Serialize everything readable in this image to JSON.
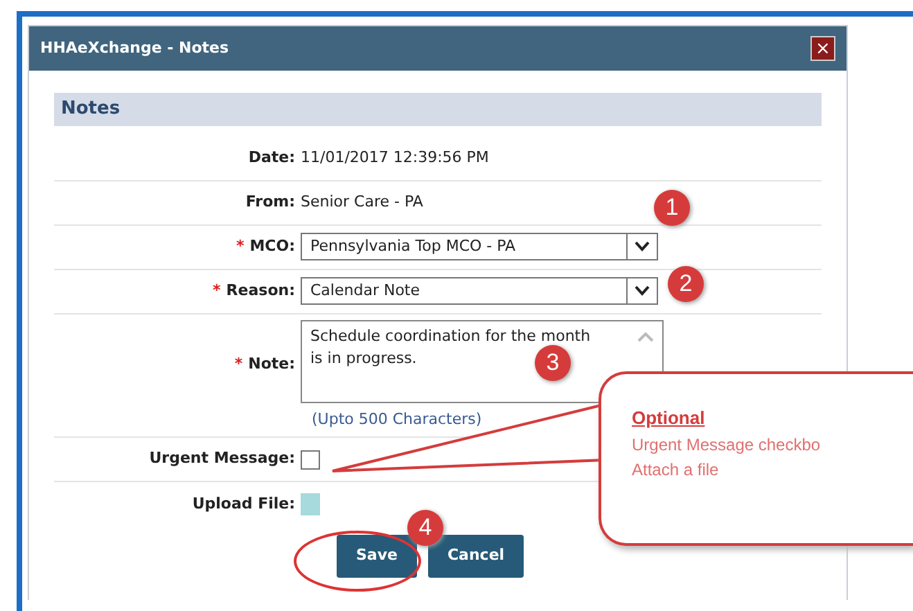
{
  "window": {
    "title": "HHAeXchange - Notes",
    "close": "×"
  },
  "section": {
    "title": "Notes"
  },
  "fields": [
    {
      "kind": "text",
      "label": "Date:",
      "value": "11/01/2017 12:39:56 PM"
    },
    {
      "kind": "text",
      "label": "From:",
      "value": "Senior Care - PA"
    },
    {
      "kind": "select",
      "required_mark": "*",
      "label": "MCO:",
      "value": "Pennsylvania Top MCO - PA"
    },
    {
      "kind": "select",
      "required_mark": "*",
      "label": "Reason:",
      "value": "Calendar Note"
    },
    {
      "kind": "textarea",
      "required_mark": "*",
      "label": "Note:",
      "value": "Schedule coordination for the month is in progress.",
      "hint": "(Upto 500 Characters)"
    },
    {
      "kind": "checkbox",
      "label": "Urgent Message:",
      "checked": false
    },
    {
      "kind": "file",
      "label": "Upload File:"
    }
  ],
  "buttons": [
    {
      "label": "Save",
      "highlighted": true
    },
    {
      "label": "Cancel",
      "highlighted": false
    }
  ],
  "annotations": [
    {
      "number": "1"
    },
    {
      "number": "2"
    },
    {
      "number": "3"
    },
    {
      "number": "4"
    }
  ],
  "callout": {
    "title": "Optional",
    "lines": [
      "Urgent Message checkbo",
      "Attach a file"
    ]
  }
}
